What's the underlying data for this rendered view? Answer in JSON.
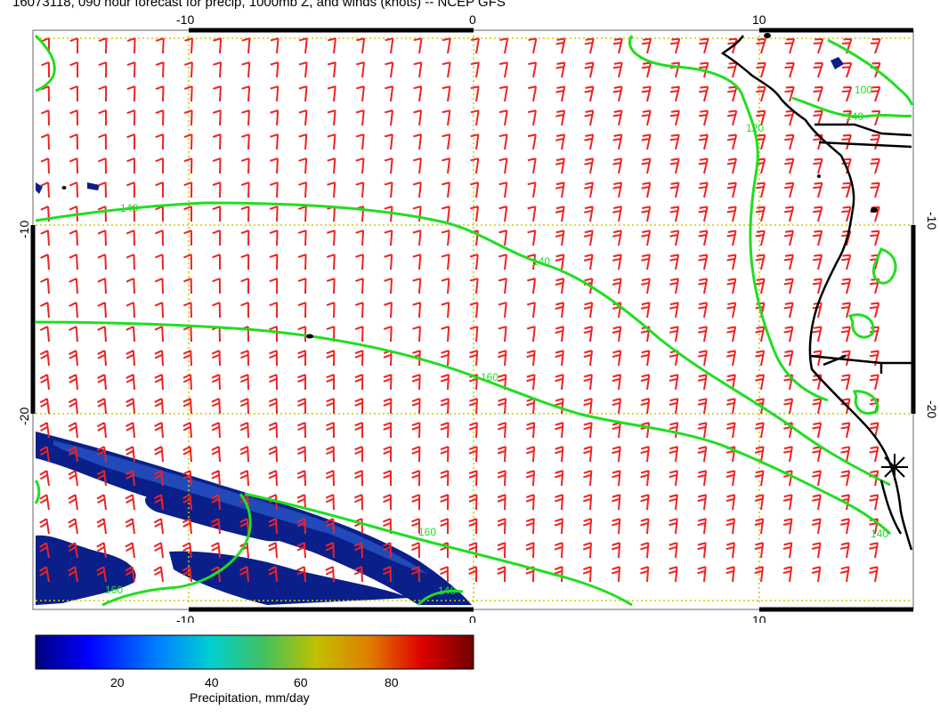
{
  "title": "16073118, 090 hour forecast for precip, 1000mb Z, and winds (knots) -- NCEP GFS",
  "map": {
    "lon_ticks": [
      "-10",
      "0",
      "10"
    ],
    "lat_ticks": [
      "-10",
      "-20"
    ],
    "contour_labels": [
      "140",
      "140",
      "160",
      "160",
      "160",
      "140",
      "120",
      "100",
      "140",
      "140"
    ],
    "colors": {
      "contour": "#22dd22",
      "barb": "#ee2222",
      "coast": "#000000",
      "grid": "#cccc00",
      "precip_dark": "#0a1f8a",
      "precip_light": "#2a58c8"
    },
    "barbs": "wind-barb-field"
  },
  "colorbar": {
    "ticks": [
      "20",
      "40",
      "60",
      "80"
    ],
    "label": "Precipitation, mm/day",
    "colors": [
      "#00007f",
      "#0000ff",
      "#0080ff",
      "#00d0d0",
      "#40c060",
      "#c0c000",
      "#e08000",
      "#e00000",
      "#700000"
    ]
  }
}
